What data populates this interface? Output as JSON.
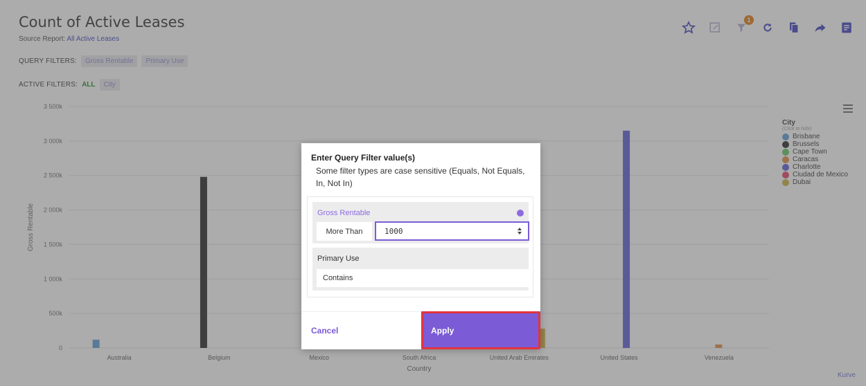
{
  "header": {
    "title": "Count of Active Leases",
    "source_prefix": "Source Report:",
    "source_link": "All Active Leases",
    "query_filters_label": "QUERY FILTERS:",
    "query_filters": [
      "Gross Rentable",
      "Primary Use"
    ],
    "active_filters_label": "ACTIVE FILTERS:",
    "active_all": "ALL",
    "active_filters": [
      "City"
    ]
  },
  "toolbar": {
    "icons": [
      "star-icon",
      "edit-icon",
      "filter-icon",
      "refresh-icon",
      "copy-icon",
      "share-icon",
      "notes-icon"
    ],
    "filter_badge": "1"
  },
  "chart_data": {
    "type": "bar",
    "xlabel": "Country",
    "ylabel": "Gross Rentable",
    "categories": [
      "Australia",
      "Belgium",
      "Mexico",
      "South Africa",
      "United Arab Emirates",
      "United States",
      "Venezuela"
    ],
    "ytick_labels": [
      "0",
      "500k",
      "1 000k",
      "1 500k",
      "2 000k",
      "2 500k",
      "3 000k",
      "3 500k"
    ],
    "ylim": [
      0,
      3500000
    ],
    "grid": true,
    "legend_position": "right",
    "legend_title": "City",
    "legend_subtitle": "(Click to hide)",
    "series": [
      {
        "name": "Brisbane",
        "color": "#5b9bd5",
        "values": [
          120000,
          0,
          0,
          0,
          0,
          0,
          0
        ]
      },
      {
        "name": "Brussels",
        "color": "#222222",
        "values": [
          0,
          2480000,
          0,
          0,
          0,
          0,
          0
        ]
      },
      {
        "name": "Cape Town",
        "color": "#5cc45c",
        "values": [
          0,
          0,
          0,
          0,
          0,
          0,
          0
        ]
      },
      {
        "name": "Caracas",
        "color": "#e08a3c",
        "values": [
          0,
          0,
          0,
          0,
          0,
          0,
          50000
        ]
      },
      {
        "name": "Charlotte",
        "color": "#5b5bd6",
        "values": [
          0,
          0,
          0,
          0,
          0,
          3150000,
          0
        ]
      },
      {
        "name": "Ciudad de Mexico",
        "color": "#e0406a",
        "values": [
          0,
          0,
          0,
          0,
          0,
          0,
          0
        ]
      },
      {
        "name": "Dubai",
        "color": "#c9b13b",
        "values": [
          0,
          0,
          0,
          0,
          280000,
          0,
          0
        ]
      }
    ],
    "credit": "Kurve"
  },
  "modal": {
    "title": "Enter Query Filter value(s)",
    "description": "Some filter types are case sensitive (Equals, Not Equals, In, Not In)",
    "filter1_label": "Gross Rentable",
    "filter1_operator": "More Than",
    "filter1_value": "1000",
    "filter2_label": "Primary Use",
    "filter2_operator": "Contains",
    "cancel_label": "Cancel",
    "apply_label": "Apply",
    "accent_color": "#7b5bd6",
    "highlight_color": "#e3343c"
  }
}
